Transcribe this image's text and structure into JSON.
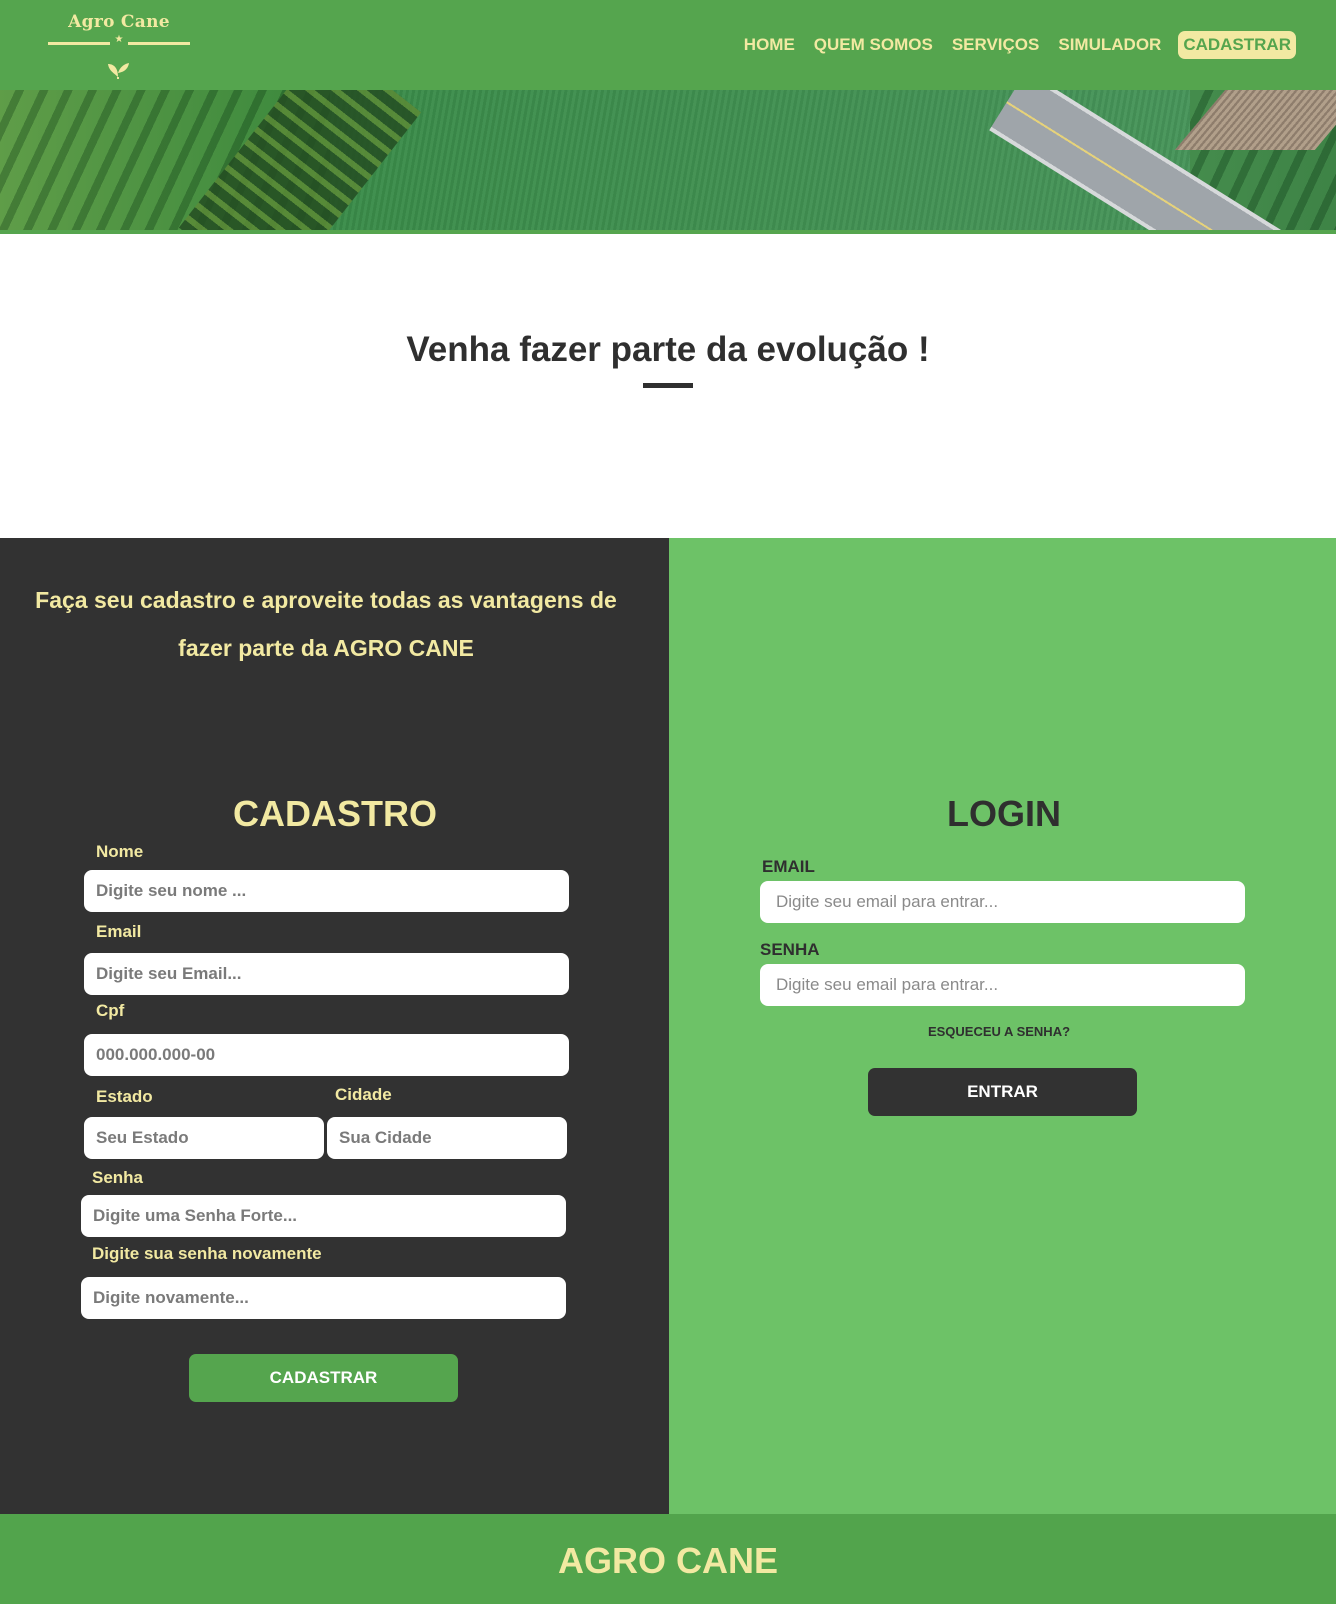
{
  "brand": {
    "logo_text": "Agro Cane",
    "colors": {
      "primary_green": "#55a54e",
      "light_green": "#6dc267",
      "cream": "#f2e9a2",
      "dark": "#323232"
    }
  },
  "nav": {
    "items": [
      {
        "label": "HOME",
        "active": false
      },
      {
        "label": "QUEM SOMOS",
        "active": false
      },
      {
        "label": "SERVIÇOS",
        "active": false
      },
      {
        "label": "SIMULADOR",
        "active": false
      },
      {
        "label": "CADASTRAR",
        "active": true
      }
    ]
  },
  "section": {
    "title": "Venha fazer parte da evolução !"
  },
  "cadastro": {
    "promo": "Faça seu cadastro e aproveite todas as vantagens de fazer parte da AGRO CANE",
    "title": "CADASTRO",
    "fields": {
      "nome": {
        "label": "Nome",
        "placeholder": "Digite seu nome ...",
        "value": ""
      },
      "email": {
        "label": "Email",
        "placeholder": "Digite seu Email...",
        "value": ""
      },
      "cpf": {
        "label": "Cpf",
        "placeholder": "000.000.000-00",
        "value": ""
      },
      "estado": {
        "label": "Estado",
        "placeholder": "Seu Estado",
        "value": ""
      },
      "cidade": {
        "label": "Cidade",
        "placeholder": "Sua Cidade",
        "value": ""
      },
      "senha": {
        "label": "Senha",
        "placeholder": "Digite uma Senha Forte...",
        "value": ""
      },
      "senha2": {
        "label": "Digite sua senha novamente",
        "placeholder": "Digite novamente...",
        "value": ""
      }
    },
    "submit_label": "CADASTRAR"
  },
  "login": {
    "title": "LOGIN",
    "fields": {
      "email": {
        "label": "EMAIL",
        "placeholder": "Digite seu email para entrar...",
        "value": ""
      },
      "senha": {
        "label": "SENHA",
        "placeholder": "Digite seu email para entrar...",
        "value": ""
      }
    },
    "forgot_label": "ESQUECEU A SENHA?",
    "submit_label": "ENTRAR"
  },
  "footer": {
    "title": "AGRO CANE"
  },
  "icons": {
    "logo_leaf": "leaf-icon",
    "logo_star": "star-icon"
  }
}
